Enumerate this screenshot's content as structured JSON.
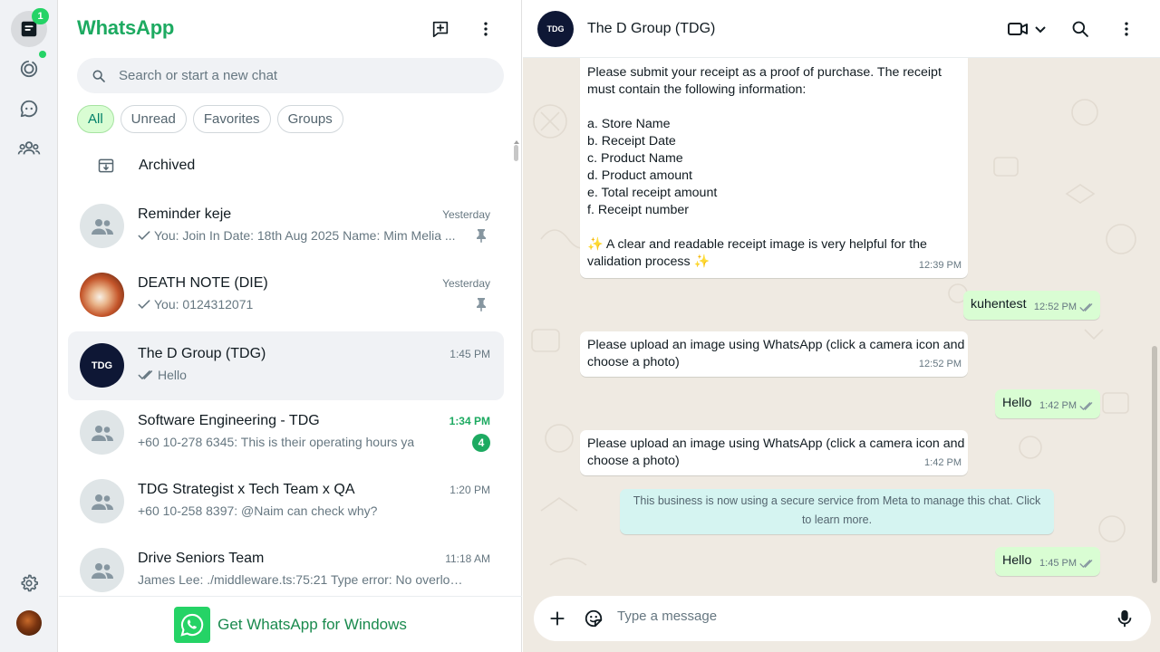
{
  "app": {
    "title": "WhatsApp",
    "rail_badge": "1"
  },
  "search": {
    "placeholder": "Search or start a new chat"
  },
  "filters": [
    {
      "label": "All",
      "active": true
    },
    {
      "label": "Unread",
      "active": false
    },
    {
      "label": "Favorites",
      "active": false
    },
    {
      "label": "Groups",
      "active": false
    }
  ],
  "archived": {
    "label": "Archived"
  },
  "chats": [
    {
      "name": "Reminder keje",
      "time": "Yesterday",
      "preview": "You: Join In Date: 18th  Aug 2025 Name: Mim Melia ...",
      "tick": "single",
      "pinned": true,
      "avatar": "group-icon"
    },
    {
      "name": "DEATH NOTE (DIE)",
      "time": "Yesterday",
      "preview": "You: 0124312071",
      "tick": "single",
      "pinned": true,
      "avatar": "photo"
    },
    {
      "name": "The D Group (TDG)",
      "time": "1:45 PM",
      "preview": "Hello",
      "tick": "double",
      "selected": true,
      "avatar": "tdg-logo"
    },
    {
      "name": "Software Engineering - TDG",
      "time": "1:34 PM",
      "preview": "+60 10-278 6345: This is their operating hours ya",
      "unread": "4",
      "avatar": "group-icon"
    },
    {
      "name": "TDG Strategist x Tech Team x QA",
      "time": "1:20 PM",
      "preview": "+60 10-258 8397: @Naim can check why?",
      "avatar": "group-icon"
    },
    {
      "name": "Drive Seniors Team",
      "time": "11:18 AM",
      "preview": "James Lee: ./middleware.ts:75:21 Type error: No overload m...",
      "avatar": "group-icon"
    }
  ],
  "get_app": {
    "label": "Get WhatsApp for Windows"
  },
  "conversation": {
    "title": "The D Group (TDG)",
    "avatar_text": "TDG",
    "messages": [
      {
        "dir": "in",
        "text": "Please submit your receipt as a proof of purchase. The receipt must contain the following information:\n\na. Store Name\nb. Receipt Date\nc. Product Name\nd. Product amount\ne. Total receipt amount\nf. Receipt number\n\n✨ A clear and readable receipt image is very helpful for the validation process ✨",
        "time": "12:39 PM"
      },
      {
        "dir": "out",
        "text": "kuhentest",
        "time": "12:52 PM"
      },
      {
        "dir": "in",
        "text": "Please upload an image using WhatsApp (click a camera icon and choose a photo)",
        "time": "12:52 PM"
      },
      {
        "dir": "out",
        "text": "Hello",
        "time": "1:42 PM"
      },
      {
        "dir": "in",
        "text": "Please upload an image using WhatsApp (click a camera icon and choose a photo)",
        "time": "1:42 PM"
      },
      {
        "dir": "out",
        "text": "Hello",
        "time": "1:45 PM"
      }
    ],
    "system_notice": "This business is now using a secure service from Meta to manage this chat. Click to learn more.",
    "composer_placeholder": "Type a message"
  },
  "colors": {
    "brand": "#1daa61",
    "outgoing": "#d9fdd3",
    "incoming": "#ffffff",
    "wallpaper": "#efeae2",
    "notice": "#d5f4f1"
  }
}
